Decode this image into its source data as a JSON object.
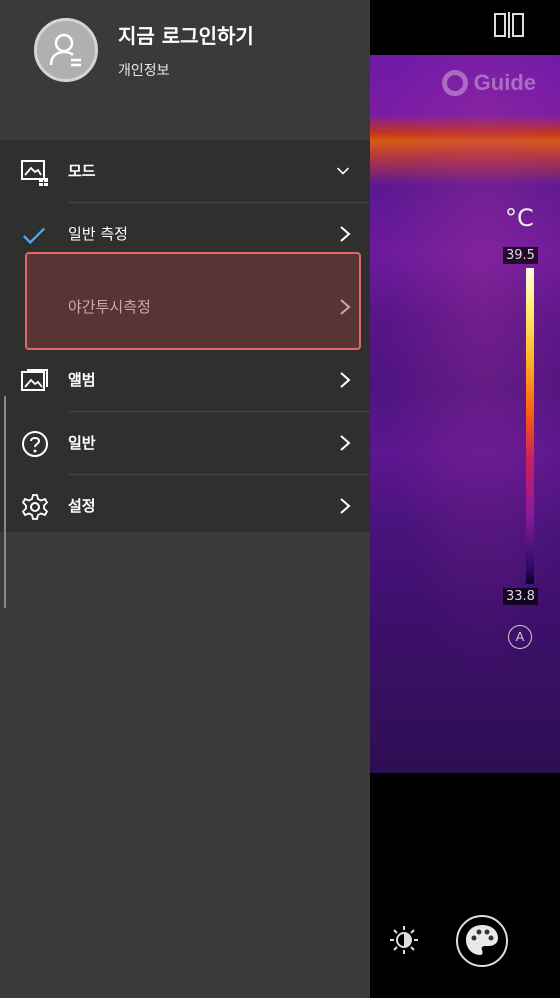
{
  "camera": {
    "watermark": "Guide",
    "unit": "°C",
    "temp_max": "39.5",
    "temp_min": "33.8",
    "auto_label": "A",
    "icons": [
      "split-view-icon",
      "brightness-icon",
      "palette-icon"
    ]
  },
  "drawer": {
    "header": {
      "login_title": "지금 로그인하기",
      "profile_link": "개인정보",
      "avatar_icon": "user-avatar-icon"
    },
    "menu": {
      "mode": {
        "label": "모드",
        "icon": "mode-icon",
        "state": "expanded"
      },
      "normal_measure": {
        "label": "일반 측정",
        "selected": true
      },
      "night_measure": {
        "label": "야간투시측정"
      },
      "album": {
        "label": "앨범",
        "icon": "album-icon"
      },
      "general": {
        "label": "일반",
        "icon": "help-icon"
      },
      "settings": {
        "label": "설정",
        "icon": "gear-icon"
      }
    }
  },
  "colors": {
    "drawer_bg": "#3a3b39",
    "menu_bg": "#2f302e",
    "check_accent": "#4aa8ff",
    "highlight_border": "#e06a6a"
  }
}
